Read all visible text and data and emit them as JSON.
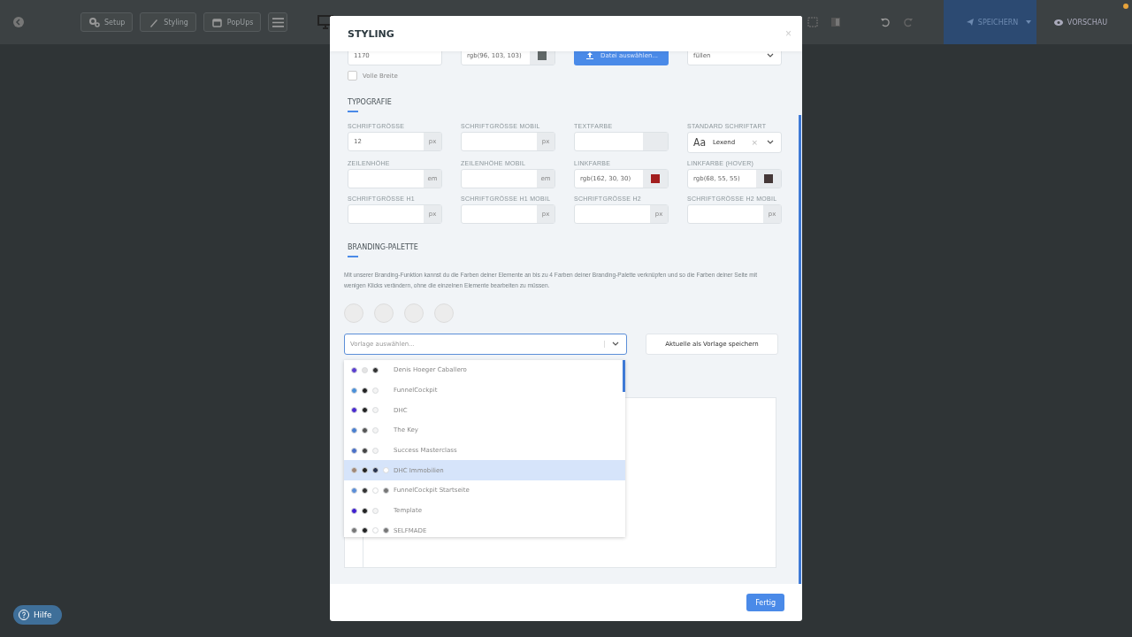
{
  "toolbar": {
    "buttons": [
      {
        "label": "Setup"
      },
      {
        "label": "Styling"
      },
      {
        "label": "PopUps"
      }
    ],
    "save": "SPEICHERN",
    "preview": "VORSCHAU"
  },
  "modal": {
    "title": "STYLING",
    "close": "×",
    "top_row": [
      {
        "kind": "text",
        "value": "1170"
      },
      {
        "kind": "color",
        "value": "rgb(96, 103, 103)",
        "color": "#606767"
      },
      {
        "kind": "file",
        "value": "Datei auswählen..."
      },
      {
        "kind": "select",
        "value": "füllen"
      }
    ],
    "full_width": {
      "label": "Volle Breite",
      "checked": false
    },
    "typography": {
      "title": "TYPOGRAFIE",
      "fields": [
        {
          "kind": "unit",
          "label": "SCHRIFTGRÖSSE",
          "value": "12",
          "unit": "px"
        },
        {
          "kind": "unit",
          "label": "SCHRIFTGRÖSSE MOBIL",
          "unit": "px"
        },
        {
          "kind": "color",
          "label": "TEXTFARBE"
        },
        {
          "kind": "font",
          "label": "STANDARD SCHRIFTART",
          "sample": "Aa",
          "value": "Lexend",
          "clear": "×"
        },
        {
          "kind": "unit",
          "label": "ZEILENHÖHE",
          "unit": "em"
        },
        {
          "kind": "unit",
          "label": "ZEILENHÖHE MOBIL",
          "unit": "em"
        },
        {
          "kind": "color",
          "label": "LINKFARBE",
          "value": "rgb(162, 30, 30)",
          "color": "#a21e1e"
        },
        {
          "kind": "color",
          "label": "LINKFARBE (HOVER)",
          "value": "rgb(68, 55, 55)",
          "color": "#443737"
        },
        {
          "kind": "unit",
          "label": "SCHRIFTGRÖSSE H1",
          "unit": "px"
        },
        {
          "kind": "unit",
          "label": "SCHRIFTGRÖSSE H1 MOBIL",
          "unit": "px"
        },
        {
          "kind": "unit",
          "label": "SCHRIFTGRÖSSE H2",
          "unit": "px"
        },
        {
          "kind": "unit",
          "label": "SCHRIFTGRÖSSE H2 MOBIL",
          "unit": "px"
        }
      ]
    },
    "branding": {
      "title": "BRANDING-PALETTE",
      "description": "Mit unserer Branding-Funktion kannst du die Farben deiner Elemente an bis zu 4 Farben deiner Branding-Palette verknüpfen und so die Farben deiner Seite mit wenigen Klicks verändern, ohne die einzelnen Elemente bearbeiten zu müssen.",
      "template_select": {
        "placeholder": "Vorlage auswählen...",
        "expanded": true
      },
      "save_template": "Aktuelle als Vorlage speichern",
      "templates": [
        {
          "name": "Denis Hoeger Caballero",
          "selected": false,
          "dots": [
            {
              "color": "#5b3fd0"
            },
            {
              "color": "#e4e4e4"
            },
            {
              "color": "#333333"
            }
          ]
        },
        {
          "name": "FunnelCockpit",
          "selected": false,
          "dots": [
            {
              "color": "#4a90d9"
            },
            {
              "color": "#222222"
            },
            {
              "color": "#f4f4f4"
            }
          ]
        },
        {
          "name": "DHC",
          "selected": false,
          "dots": [
            {
              "color": "#4b2bd0"
            },
            {
              "color": "#222222"
            },
            {
              "color": "#f4f4f4"
            }
          ]
        },
        {
          "name": "The Key",
          "selected": false,
          "dots": [
            {
              "color": "#4a7fd0"
            },
            {
              "color": "#555555"
            },
            {
              "color": "#f4f4f4"
            }
          ]
        },
        {
          "name": "Success Masterclass",
          "selected": false,
          "dots": [
            {
              "color": "#4a70c8"
            },
            {
              "color": "#444444"
            },
            {
              "color": "#f4f4f4"
            }
          ]
        },
        {
          "name": "DHC Immobilien",
          "selected": true,
          "dots": [
            {
              "color": "#a08878"
            },
            {
              "color": "#222222"
            },
            {
              "color": "#2a3550"
            },
            {
              "color": "#ffffff"
            }
          ]
        },
        {
          "name": "FunnelCockpit Startseite",
          "selected": false,
          "dots": [
            {
              "color": "#5b8ed8"
            },
            {
              "color": "#333333"
            },
            {
              "color": "#ffffff"
            },
            {
              "color": "#777777"
            }
          ]
        },
        {
          "name": "Template",
          "selected": false,
          "dots": [
            {
              "color": "#4020d0"
            },
            {
              "color": "#222222"
            },
            {
              "color": "#f4f4f4"
            }
          ]
        },
        {
          "name": "SELFMADE",
          "selected": false,
          "dots": [
            {
              "color": "#777777"
            },
            {
              "color": "#222222"
            },
            {
              "color": "#ffffff"
            },
            {
              "color": "#777777"
            }
          ]
        }
      ]
    },
    "done": "Fertig"
  },
  "help": "Hilfe"
}
